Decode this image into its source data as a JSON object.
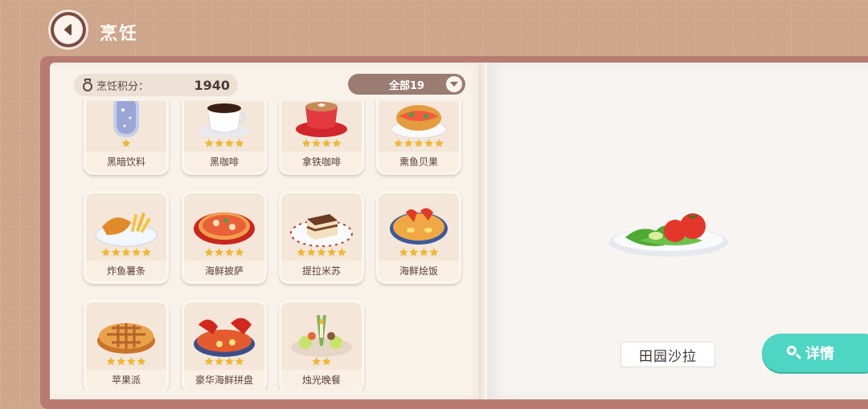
{
  "header": {
    "title": "烹饪",
    "back_icon": "back-arrow-icon"
  },
  "score": {
    "label": "烹饪积分：",
    "value": "1940",
    "icon": "medal-icon"
  },
  "filter": {
    "label": "全部19",
    "icon": "chevron-down-icon"
  },
  "recipes": [
    {
      "name": "黑暗饮料",
      "stars": 1,
      "food": "dark-drink"
    },
    {
      "name": "黑咖啡",
      "stars": 4,
      "food": "black-coffee"
    },
    {
      "name": "拿铁咖啡",
      "stars": 4,
      "food": "latte"
    },
    {
      "name": "熏鱼贝果",
      "stars": 5,
      "food": "bagel"
    },
    {
      "name": "炸鱼薯条",
      "stars": 5,
      "food": "fish-chips"
    },
    {
      "name": "海鲜披萨",
      "stars": 4,
      "food": "seafood-pizza"
    },
    {
      "name": "提拉米苏",
      "stars": 5,
      "food": "tiramisu"
    },
    {
      "name": "海鲜烩饭",
      "stars": 4,
      "food": "paella"
    },
    {
      "name": "苹果派",
      "stars": 4,
      "food": "apple-pie"
    },
    {
      "name": "豪华海鲜拼盘",
      "stars": 4,
      "food": "seafood-platter"
    },
    {
      "name": "烛光晚餐",
      "stars": 2,
      "food": "candlelight-dinner"
    }
  ],
  "preview": {
    "dish_name": "田园沙拉",
    "food": "garden-salad"
  },
  "detail_button": {
    "label": "详情",
    "icon": "search-icon"
  },
  "colors": {
    "accent": "#4fd5c3",
    "star": "#f5b91e",
    "book": "#b77b72",
    "background": "#cda68b"
  }
}
